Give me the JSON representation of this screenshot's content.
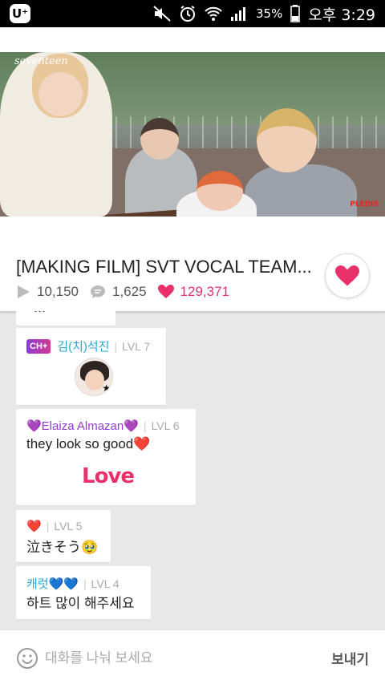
{
  "status_bar": {
    "battery": "35%",
    "time": "오후 3:29"
  },
  "video": {
    "overlay_logo": "seventeen",
    "watermark": "PLEDIS"
  },
  "post": {
    "title": "[MAKING FILM] SVT VOCAL TEAM...",
    "views": "10,150",
    "comments": "1,625",
    "likes": "129,371"
  },
  "chat": {
    "cut_message": "...",
    "messages": [
      {
        "badge": "CH+",
        "nickname": "김(치)석진",
        "level": "LVL 7",
        "sticker": "member-photo-sticker"
      },
      {
        "nickname": "💜Elaiza Almazan💜",
        "level": "LVL 6",
        "text": "they look so good❤️",
        "sticker_text": "Love"
      },
      {
        "nickname": "❤️",
        "level": "LVL 5",
        "text": "泣きそう🥹"
      },
      {
        "nickname": "캐럿💙💙",
        "level": "LVL 4",
        "text": "하트 많이 해주세요"
      }
    ]
  },
  "input": {
    "placeholder": "대화를 나눠 보세요",
    "send_label": "보내기"
  },
  "colors": {
    "accent_pink": "#e8316b",
    "nick_blue": "#26a6d6",
    "nick_purple": "#8e3ad6"
  }
}
